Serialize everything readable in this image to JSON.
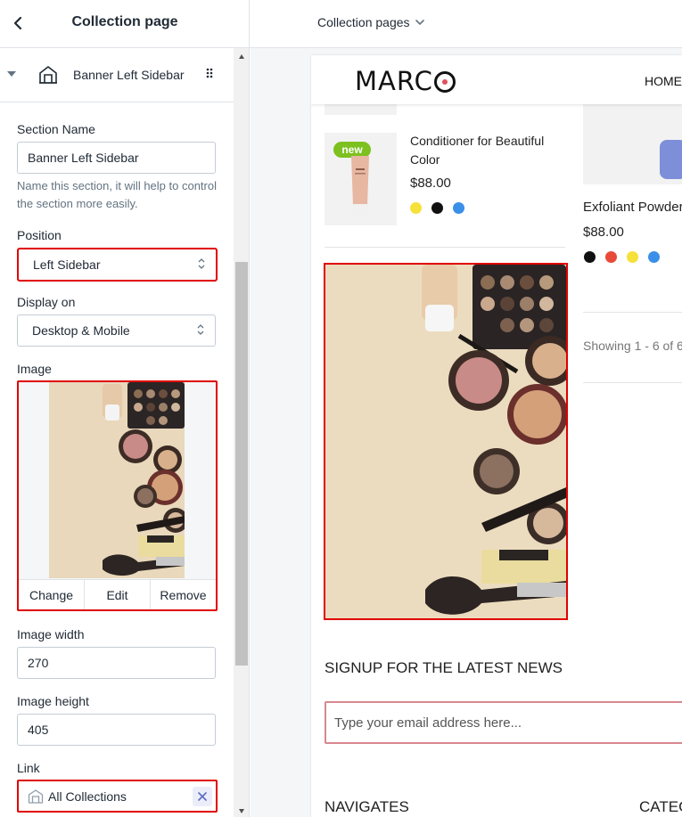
{
  "left_panel": {
    "title": "Collection page",
    "section_row_label": "Banner Left Sidebar",
    "fields": {
      "section_name_label": "Section Name",
      "section_name_value": "Banner Left Sidebar",
      "section_name_hint": "Name this section, it will help to control the section more easily.",
      "position_label": "Position",
      "position_value": "Left Sidebar",
      "display_on_label": "Display on",
      "display_on_value": "Desktop & Mobile",
      "image_label": "Image",
      "image_actions": [
        "Change",
        "Edit",
        "Remove"
      ],
      "image_width_label": "Image width",
      "image_width_value": "270",
      "image_height_label": "Image height",
      "image_height_value": "405",
      "link_label": "Link",
      "link_value": "All Collections"
    }
  },
  "top_bar": {
    "page_picker": "Collection pages"
  },
  "preview": {
    "logo": "MARC",
    "nav_home": "HOME",
    "badge": "new",
    "product": {
      "name": "Conditioner for Beautiful Color",
      "price": "$88.00",
      "swatches": [
        "#f6e03a",
        "#111111",
        "#3a8fe8"
      ]
    },
    "side_product": {
      "name": "Exfoliant Powder",
      "price": "$88.00",
      "swatches": [
        "#111111",
        "#e84a3a",
        "#f6e03a",
        "#3a8fe8"
      ]
    },
    "showing_text": "Showing 1 - 6 of 6",
    "signup_title": "SIGNUP FOR THE LATEST NEWS",
    "email_placeholder": "Type your email address here...",
    "footer_navigates": "NAVIGATES",
    "footer_categories": "CATEG"
  },
  "colors": {
    "highlight": "#e00000",
    "badge_green": "#7cc11f",
    "email_border": "#d9888f"
  }
}
